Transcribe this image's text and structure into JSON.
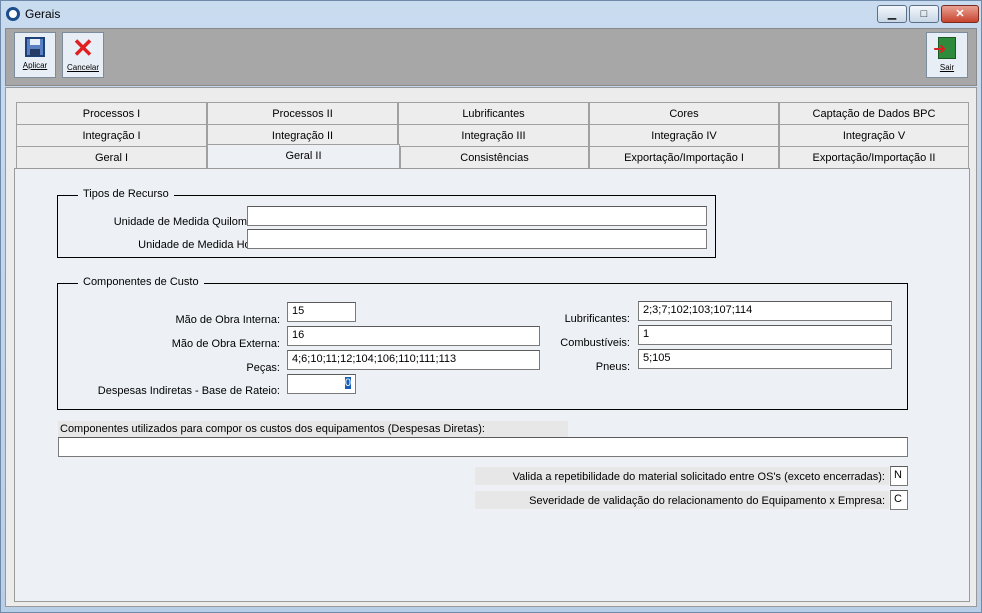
{
  "window": {
    "title": "Gerais",
    "min": "▁",
    "max": "□",
    "close": "✕"
  },
  "toolbar": {
    "save_label": "Aplicar",
    "cancel_label": "Cancelar",
    "exit_label": "Sair"
  },
  "tabs": {
    "row1": [
      "Processos I",
      "Processos II",
      "Lubrificantes",
      "Cores",
      "Captação de Dados BPC"
    ],
    "row2": [
      "Integração I",
      "Integração II",
      "Integração III",
      "Integração IV",
      "Integração V"
    ],
    "row3": [
      "Geral I",
      "Geral II",
      "Consistências",
      "Exportação/Importação I",
      "Exportação/Importação II"
    ],
    "active": "Geral II"
  },
  "tipos_recurso": {
    "legend": "Tipos de Recurso",
    "km_label": "Unidade de Medida Quilometro:",
    "km_value": "",
    "horas_label": "Unidade de Medida Horas:",
    "horas_value": ""
  },
  "componentes": {
    "legend": "Componentes de Custo",
    "mo_interna_label": "Mão de Obra Interna:",
    "mo_interna_value": "15",
    "mo_externa_label": "Mão de Obra Externa:",
    "mo_externa_value": "16",
    "pecas_label": "Peças:",
    "pecas_value": "4;6;10;11;12;104;106;110;111;113",
    "despesas_label": "Despesas Indiretas - Base de Rateio:",
    "despesas_value": "0",
    "lubrificantes_label": "Lubrificantes:",
    "lubrificantes_value": "2;3;7;102;103;107;114",
    "combustiveis_label": "Combustíveis:",
    "combustiveis_value": "1",
    "pneus_label": "Pneus:",
    "pneus_value": "5;105"
  },
  "despesas_diretas": {
    "label": "Componentes utilizados para compor os custos dos equipamentos (Despesas Diretas):",
    "value": ""
  },
  "validacao": {
    "repetibilidade_label": "Valida a repetibilidade do material solicitado entre OS's (exceto encerradas):",
    "repetibilidade_value": "N",
    "severidade_label": "Severidade de validação do relacionamento do Equipamento x Empresa:",
    "severidade_value": "C"
  }
}
